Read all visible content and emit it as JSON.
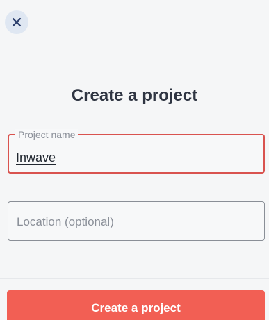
{
  "header": {
    "close_icon": "close-icon"
  },
  "main": {
    "title": "Create a project",
    "fields": [
      {
        "label": "Project name",
        "value": "Inwave"
      },
      {
        "placeholder": "Location (optional)"
      }
    ],
    "submit_label": "Create a project"
  },
  "colors": {
    "accent": "#f25f54",
    "error_border": "#d9534f",
    "close_bg": "#dfe7f2",
    "close_icon": "#2a3d6b"
  }
}
